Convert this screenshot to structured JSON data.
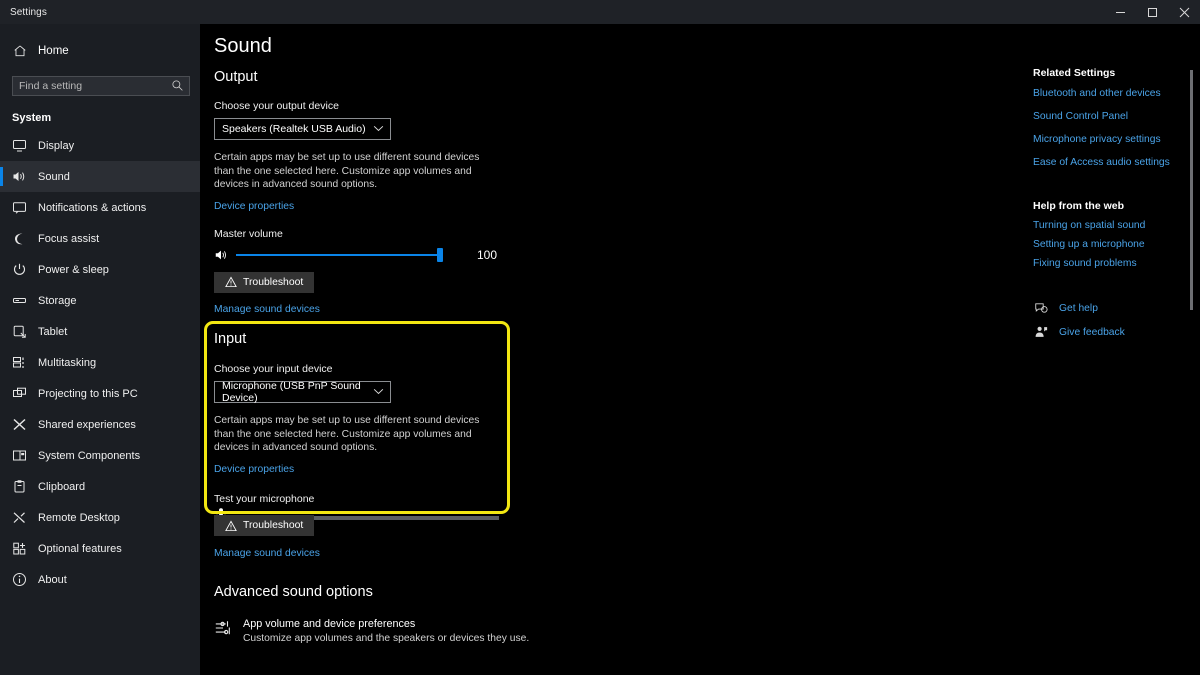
{
  "window": {
    "caption": "Settings",
    "minimize_label": "Minimize",
    "maximize_label": "Restore",
    "close_label": "Close"
  },
  "sidebar": {
    "home_label": "Home",
    "search_placeholder": "Find a setting",
    "search_value": "",
    "section_label": "System",
    "items": [
      {
        "label": "Display",
        "icon": "monitor-icon"
      },
      {
        "label": "Sound",
        "icon": "speaker-icon",
        "selected": true
      },
      {
        "label": "Notifications & actions",
        "icon": "notification-icon"
      },
      {
        "label": "Focus assist",
        "icon": "moon-icon"
      },
      {
        "label": "Power & sleep",
        "icon": "power-icon"
      },
      {
        "label": "Storage",
        "icon": "storage-icon"
      },
      {
        "label": "Tablet",
        "icon": "tablet-icon"
      },
      {
        "label": "Multitasking",
        "icon": "multitasking-icon"
      },
      {
        "label": "Projecting to this PC",
        "icon": "projecting-icon"
      },
      {
        "label": "Shared experiences",
        "icon": "shared-icon"
      },
      {
        "label": "System Components",
        "icon": "components-icon"
      },
      {
        "label": "Clipboard",
        "icon": "clipboard-icon"
      },
      {
        "label": "Remote Desktop",
        "icon": "remote-desktop-icon"
      },
      {
        "label": "Optional features",
        "icon": "optional-features-icon"
      },
      {
        "label": "About",
        "icon": "info-icon"
      }
    ]
  },
  "main": {
    "page_title": "Sound",
    "output": {
      "heading": "Output",
      "device_label": "Choose your output device",
      "device_value": "Speakers (Realtek USB Audio)",
      "note": "Certain apps may be set up to use different sound devices than the one selected here. Customize app volumes and devices in advanced sound options.",
      "device_properties_link": "Device properties",
      "volume_label": "Master volume",
      "volume_value": "100",
      "volume_percent": 100,
      "troubleshoot_label": "Troubleshoot",
      "manage_link": "Manage sound devices"
    },
    "input": {
      "heading": "Input",
      "device_label": "Choose your input device",
      "device_value": "Microphone (USB PnP Sound Device)",
      "note": "Certain apps may be set up to use different sound devices than the one selected here. Customize app volumes and devices in advanced sound options.",
      "device_properties_link": "Device properties",
      "test_label": "Test your microphone",
      "test_level_percent": 3,
      "troubleshoot_label": "Troubleshoot",
      "manage_link": "Manage sound devices",
      "highlight_color": "#f2e712"
    },
    "advanced": {
      "heading": "Advanced sound options",
      "item_title": "App volume and device preferences",
      "item_subtitle": "Customize app volumes and the speakers or devices they use."
    }
  },
  "rail": {
    "related_heading": "Related Settings",
    "related_links": [
      "Bluetooth and other devices",
      "Sound Control Panel",
      "Microphone privacy settings",
      "Ease of Access audio settings"
    ],
    "help_heading": "Help from the web",
    "help_links": [
      "Turning on spatial sound",
      "Setting up a microphone",
      "Fixing sound problems"
    ],
    "get_help_label": "Get help",
    "give_feedback_label": "Give feedback"
  },
  "colors": {
    "accent": "#0a84e8",
    "link": "#4aa3e8",
    "highlight": "#f2e712",
    "sidebar_bg": "#1b1e23",
    "content_bg": "#000000"
  }
}
